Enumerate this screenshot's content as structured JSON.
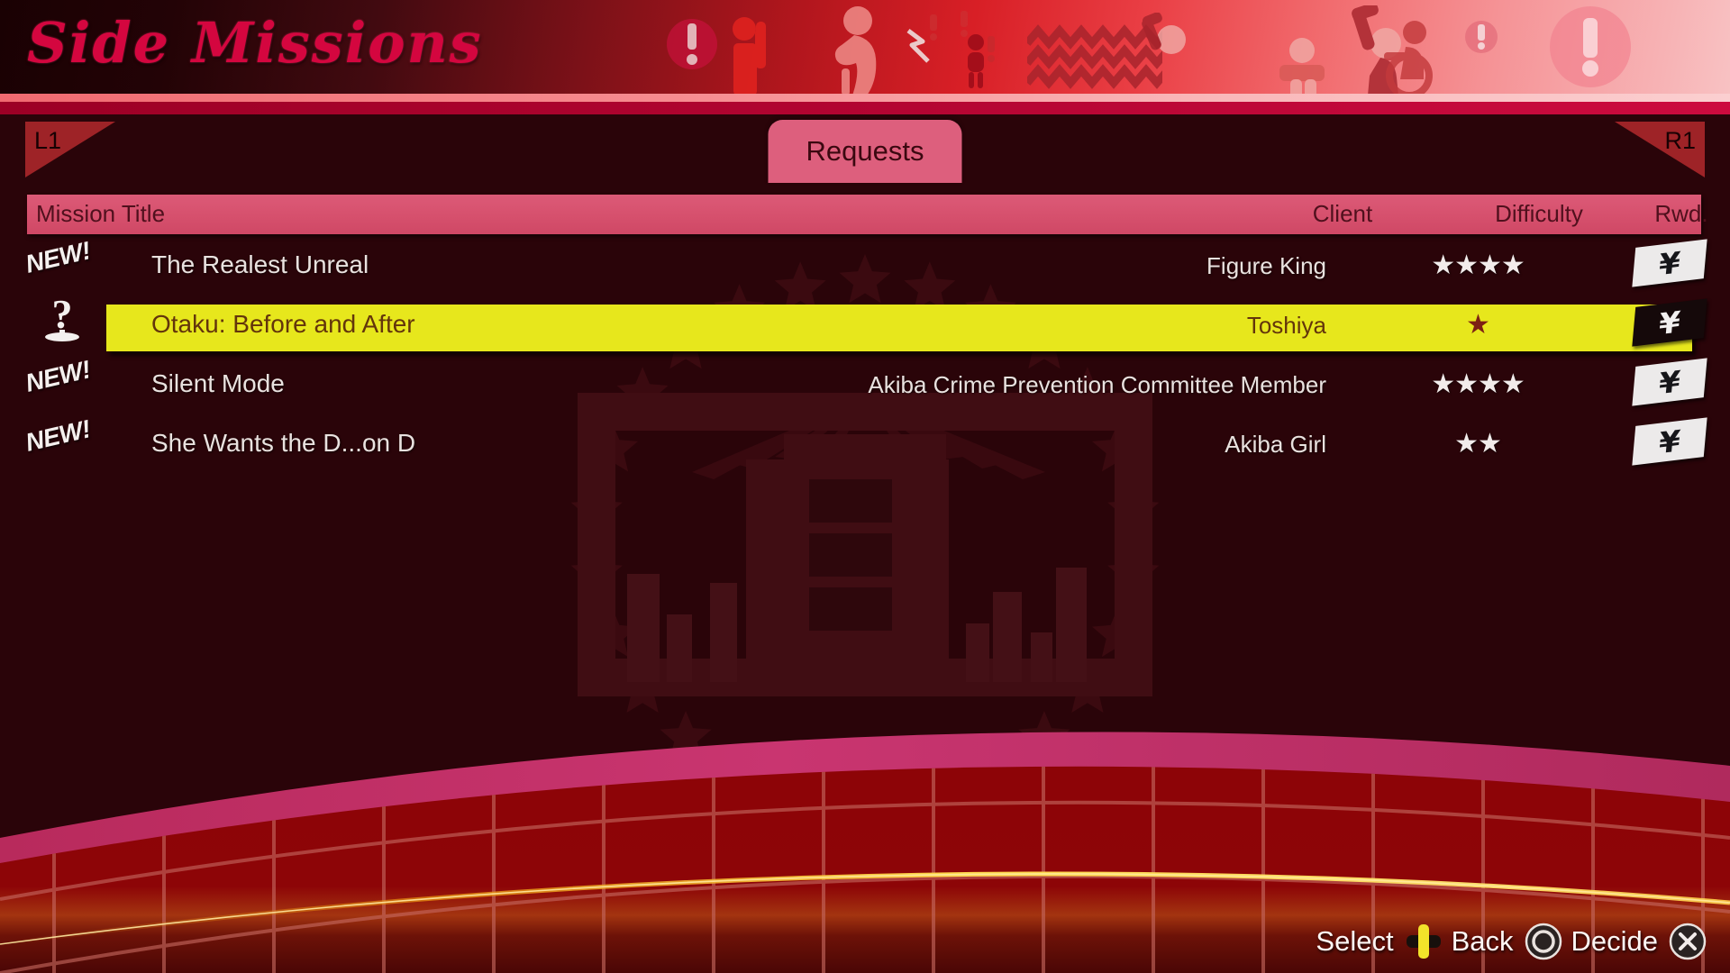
{
  "header": {
    "title": "Side Missions",
    "icons": [
      "exclamation-circle-icon",
      "person-raising-hand-icon",
      "person-running-icon",
      "small-person-icon",
      "water-waves-icon",
      "person-swinging-bat-icon",
      "person-standing-icon",
      "wheelchair-person-icon",
      "exclamation-badge-icon",
      "exclamation-circle-large-icon"
    ]
  },
  "subbar": {
    "left_bumper": "L1",
    "right_bumper": "R1",
    "tab": {
      "label": "Requests",
      "active": true
    }
  },
  "table": {
    "columns": {
      "mission_title": "Mission Title",
      "client": "Client",
      "difficulty": "Difficulty",
      "reward": "Rwd."
    },
    "reward_symbol": "¥",
    "star_symbol": "★",
    "rows": [
      {
        "badge": "NEW!",
        "badge_type": "new",
        "title": "The Realest Unreal",
        "client": "Figure King",
        "difficulty": 4,
        "difficulty_stars": "★★★★",
        "reward": "¥",
        "selected": false
      },
      {
        "badge": "?",
        "badge_type": "question",
        "title": "Otaku: Before and After",
        "client": "Toshiya",
        "difficulty": 1,
        "difficulty_stars": "★",
        "reward": "¥",
        "selected": true
      },
      {
        "badge": "NEW!",
        "badge_type": "new",
        "title": "Silent Mode",
        "client": "Akiba Crime Prevention Committee Member",
        "difficulty": 4,
        "difficulty_stars": "★★★★",
        "reward": "¥",
        "selected": false
      },
      {
        "badge": "NEW!",
        "badge_type": "new",
        "title": "She Wants the D...on D",
        "client": "Akiba Girl",
        "difficulty": 2,
        "difficulty_stars": "★★",
        "reward": "¥",
        "selected": false
      }
    ]
  },
  "footer": {
    "select_label": "Select",
    "select_icon": "dpad-icon",
    "back_label": "Back",
    "back_icon": "circle-button-icon",
    "decide_label": "Decide",
    "decide_icon": "cross-button-icon"
  },
  "colors": {
    "accent_pink": "#dd5f7d",
    "highlight_yellow": "#e7e71c",
    "title_crimson": "#d4063f",
    "background_maroon": "#2a0409",
    "bumper_red": "#9e2327",
    "text_light": "#e9e2df",
    "selected_text": "#63350b",
    "footer_arc_pink": "#c23166",
    "footer_grid_red": "#9c0608"
  }
}
